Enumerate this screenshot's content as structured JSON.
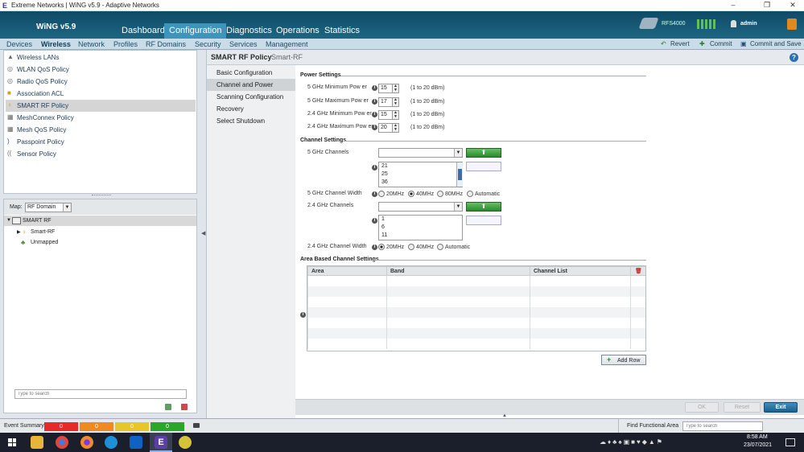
{
  "window": {
    "title": "Extreme Networks | WiNG v5.9 - Adaptive Networks",
    "controls": [
      "–",
      "❐",
      "✕"
    ]
  },
  "header": {
    "logo": "WiNG v5.9",
    "tabs": [
      "Dashboard",
      "Configuration",
      "Diagnostics",
      "Operations",
      "Statistics"
    ],
    "active_tab": "Configuration",
    "device": "RFS4000",
    "user": "admin"
  },
  "subnav": {
    "tabs": [
      "Devices",
      "Wireless",
      "Network",
      "Profiles",
      "RF Domains",
      "Security",
      "Services",
      "Management"
    ],
    "active": "Wireless",
    "actions": {
      "revert": "Revert",
      "commit": "Commit",
      "commit_save": "Commit and Save"
    }
  },
  "left": {
    "policies": [
      {
        "label": "Wireless LANs",
        "icon": "wlan-icon"
      },
      {
        "label": "WLAN QoS Policy",
        "icon": "qos-icon"
      },
      {
        "label": "Radio QoS Policy",
        "icon": "radio-qos-icon"
      },
      {
        "label": "Association ACL",
        "icon": "acl-icon"
      },
      {
        "label": "SMART RF Policy",
        "icon": "smart-rf-icon"
      },
      {
        "label": "MeshConnex Policy",
        "icon": "meshconnex-icon"
      },
      {
        "label": "Mesh QoS Policy",
        "icon": "mesh-qos-icon"
      },
      {
        "label": "Passpoint Policy",
        "icon": "passpoint-icon"
      },
      {
        "label": "Sensor Policy",
        "icon": "sensor-icon"
      }
    ],
    "selected": "SMART RF Policy",
    "map_label": "Map:",
    "map_value": "RF Domain",
    "tree": {
      "root": "SMART RF",
      "child": "Smart-RF",
      "other": "Unmapped"
    },
    "search_placeholder": "Type to search"
  },
  "content": {
    "title": "SMART RF Policy",
    "subtitle": "Smart-RF",
    "sections": [
      "Basic Configuration",
      "Channel and Power",
      "Scanning Configuration",
      "Recovery",
      "Select Shutdown"
    ],
    "selected_section": "Channel and Power",
    "power": {
      "heading": "Power Settings",
      "rows": [
        {
          "label": "5 GHz Minimum Pow er",
          "value": "15",
          "hint": "(1 to 20 dBm)"
        },
        {
          "label": "5 GHz Maximum Pow er",
          "value": "17",
          "hint": "(1 to 20 dBm)"
        },
        {
          "label": "2.4 GHz Minimum Pow er",
          "value": "15",
          "hint": "(1 to 20 dBm)"
        },
        {
          "label": "2.4 GHz Maximum Pow er",
          "value": "20",
          "hint": "(1 to 20 dBm)"
        }
      ]
    },
    "channel": {
      "heading": "Channel Settings",
      "ch5_label": "5 GHz Channels",
      "ch5_list": [
        "21",
        "25",
        "36"
      ],
      "width5_label": "5 GHz Channel Width",
      "width5_options": [
        "20MHz",
        "40MHz",
        "80MHz",
        "Automatic"
      ],
      "width5_selected": "40MHz",
      "ch24_label": "2.4 GHz Channels",
      "ch24_list": [
        "1",
        "6",
        "11"
      ],
      "width24_label": "2.4 GHz Channel Width",
      "width24_options": [
        "20MHz",
        "40MHz",
        "Automatic"
      ],
      "width24_selected": "20MHz"
    },
    "area": {
      "heading": "Area Based Channel Settings",
      "columns": [
        "Area",
        "Band",
        "Channel List"
      ],
      "add_row": "Add Row"
    },
    "buttons": {
      "ok": "OK",
      "reset": "Reset",
      "exit": "Exit"
    }
  },
  "statusbar": {
    "event_summary": "Event Summary",
    "events": [
      {
        "count": "0",
        "color": "#e62a2a"
      },
      {
        "count": "0",
        "color": "#ef8a22"
      },
      {
        "count": "0",
        "color": "#e8c52a"
      },
      {
        "count": "0",
        "color": "#2aa62a"
      }
    ],
    "find_label": "Find Functional Area",
    "find_placeholder": "Type to search"
  },
  "taskbar": {
    "time": "8:58 AM",
    "date": "23/07/2021"
  }
}
